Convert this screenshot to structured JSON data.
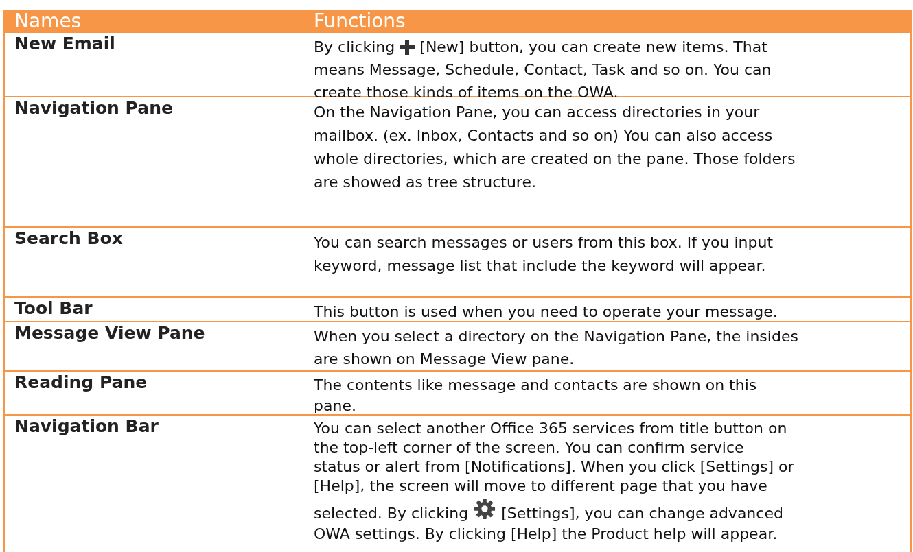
{
  "table": {
    "columns": [
      "Names",
      "Functions"
    ],
    "rows": [
      {
        "name": "New Email",
        "lines": [
          [
            {
              "kind": "text",
              "text": "By clicking"
            },
            {
              "kind": "icon"
            },
            {
              "kind": "text",
              "text": "[New] button, you can create new items. That"
            }
          ],
          [
            {
              "kind": "text",
              "text": "means Message, Schedule, Contact, Task and so on. You can"
            }
          ],
          [
            {
              "kind": "text",
              "text": "create those kinds of items on the OWA."
            }
          ]
        ]
      },
      {
        "name": "Navigation Pane",
        "lines": [
          [
            {
              "kind": "text",
              "text": "On the Navigation Pane, you can access directories in your"
            }
          ],
          [
            {
              "kind": "text",
              "text": "mailbox. (ex. Inbox, Contacts and so on) You can also access"
            }
          ],
          [
            {
              "kind": "text",
              "text": "whole directories, which are created on the pane. Those folders"
            }
          ],
          [
            {
              "kind": "text",
              "text": "are showed as tree structure."
            }
          ]
        ]
      },
      {
        "name": "Search Box",
        "lines": [
          [
            {
              "kind": "text",
              "text": "You can search messages or users from this box. If you input"
            }
          ],
          [
            {
              "kind": "text",
              "text": "keyword, message list that include the keyword will appear."
            }
          ]
        ]
      },
      {
        "name": "Tool Bar",
        "lines": [
          [
            {
              "kind": "text",
              "text": "This button is used when you need to operate your message."
            }
          ]
        ]
      },
      {
        "name": "Message View Pane",
        "lines": [
          [
            {
              "kind": "text",
              "text": "When you select a directory on the Navigation Pane, the insides"
            }
          ],
          [
            {
              "kind": "text",
              "text": "are shown on Message View pane."
            }
          ]
        ]
      },
      {
        "name": "Reading Pane",
        "lines": [
          [
            {
              "kind": "text",
              "text": "The contents like message and contacts are shown on this"
            }
          ],
          [
            {
              "kind": "text",
              "text": "pane."
            }
          ]
        ]
      },
      {
        "name": "Navigation Bar",
        "lines": [
          [
            {
              "kind": "text",
              "text": "You can select another Office 365 services from title button on"
            }
          ],
          [
            {
              "kind": "text",
              "text": "the top-left corner of the screen. You can confirm service"
            }
          ],
          [
            {
              "kind": "text",
              "text": "status or alert from [Notifications]. When you click [Settings] or"
            }
          ],
          [
            {
              "kind": "text",
              "text": "[Help], the screen will move to different page that you have"
            }
          ],
          [
            {
              "kind": "text",
              "text": "selected. By clicking"
            },
            {
              "kind": "icon"
            },
            {
              "kind": "text",
              "text": "[Settings], you can change advanced"
            }
          ],
          [
            {
              "kind": "text",
              "text": "OWA settings. By clicking [Help] the Product help will appear."
            }
          ]
        ]
      }
    ]
  }
}
